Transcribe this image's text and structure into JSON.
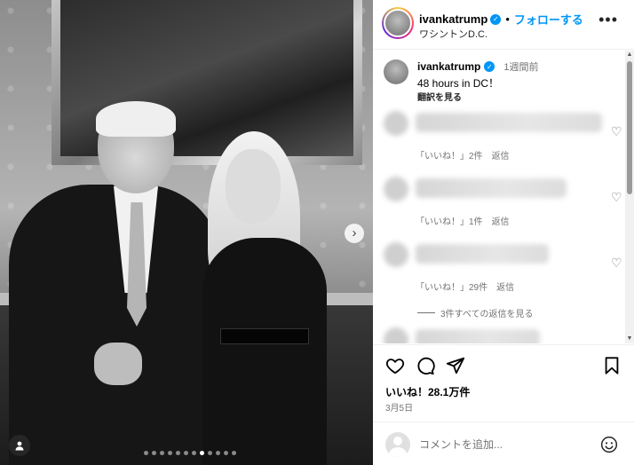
{
  "post": {
    "username": "ivankatrump",
    "separator": "•",
    "follow_label": "フォローする",
    "location": "ワシントンD.C.",
    "more_glyph": "•••",
    "photo_dots": 12,
    "active_dot": 7
  },
  "caption": {
    "username": "ivankatrump",
    "time": "1週間前",
    "text": "48 hours in DC！",
    "translate_label": "翻訳を見る"
  },
  "comments": [
    {
      "likes_label": "「いいね！」2件",
      "reply_label": "返信"
    },
    {
      "likes_label": "「いいね！」1件",
      "reply_label": "返信"
    },
    {
      "likes_label": "「いいね！」29件",
      "reply_label": "返信"
    }
  ],
  "view_replies_label": "3件すべての返信を見る",
  "actions": {
    "likes_text": "いいね！28.1万件",
    "date": "3月5日"
  },
  "comment_box": {
    "placeholder": "コメントを追加..."
  },
  "colors": {
    "accent": "#0095f6",
    "muted": "#737373"
  }
}
